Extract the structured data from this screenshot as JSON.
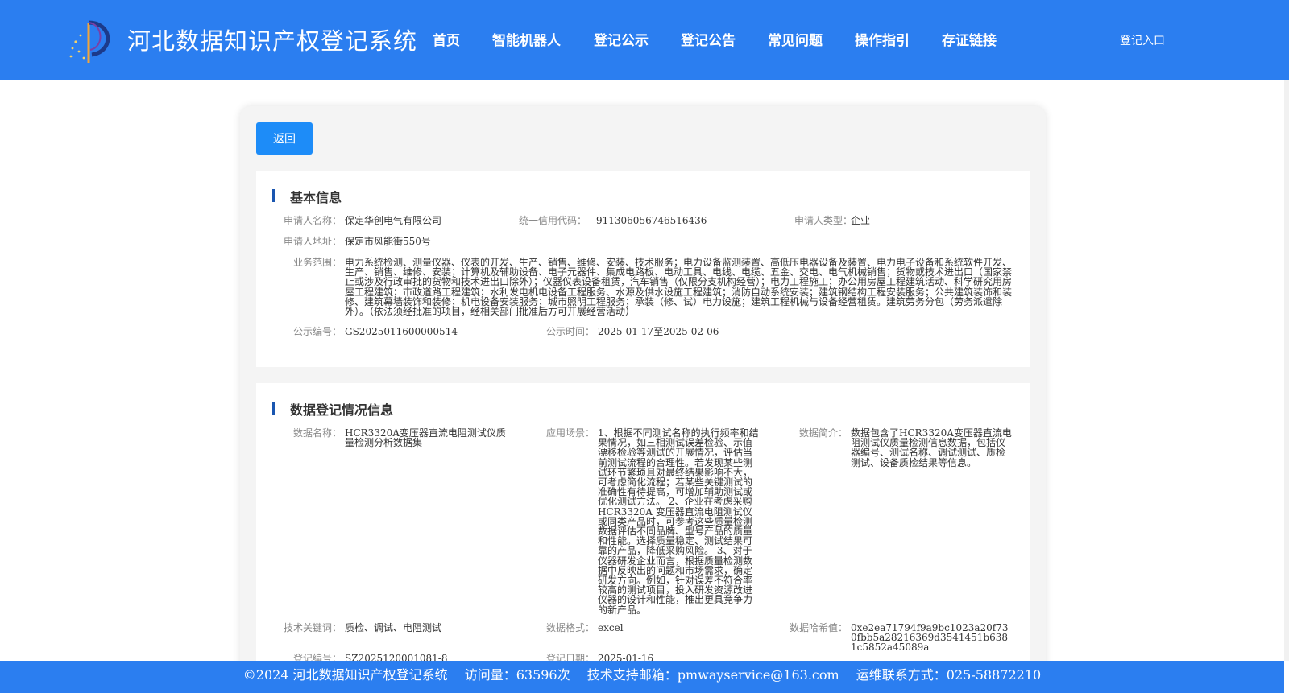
{
  "header": {
    "title": "河北数据知识产权登记系统",
    "nav": [
      "首页",
      "智能机器人",
      "登记公示",
      "登记公告",
      "常见问题",
      "操作指引",
      "存证链接"
    ],
    "login": "登记入口"
  },
  "back_label": "返回",
  "basic": {
    "title": "基本信息",
    "applicant_name_label": "申请人名称：",
    "applicant_name": "保定华创电气有限公司",
    "credit_code_label": "统一信用代码：",
    "credit_code": "911306056746516436",
    "applicant_type_label": "申请人类型：",
    "applicant_type": "企业",
    "address_label": "申请人地址：",
    "address": "保定市风能街550号",
    "scope_label": "业务范围：",
    "scope": "电力系统检测、测量仪器、仪表的开发、生产、销售、维修、安装、技术服务；电力设备监测装置、高低压电器设备及装置、电力电子设备和系统软件开发、生产、销售、维修、安装；计算机及辅助设备、电子元器件、集成电路板、电动工具、电线、电缆、五金、交电、电气机械销售；货物或技术进出口（国家禁止或涉及行政审批的货物和技术进出口除外）；仪器仪表设备租赁，汽车销售（仅限分支机构经营）；电力工程施工；办公用房屋工程建筑活动、科学研究用房屋工程建筑；市政道路工程建筑；水利发电机电设备工程服务、水源及供水设施工程建筑；消防自动系统安装；建筑钢结构工程安装服务；公共建筑装饰和装修、建筑幕墙装饰和装修；机电设备安装服务；城市照明工程服务；承装（修、试）电力设施；建筑工程机械与设备经营租赁。建筑劳务分包（劳务派遣除外）。（依法须经批准的项目，经相关部门批准后方可开展经营活动）",
    "notice_no_label": "公示编号：",
    "notice_no": "GS2025011600000514",
    "notice_time_label": "公示时间：",
    "notice_time": "2025-01-17至2025-02-06"
  },
  "registration": {
    "title": "数据登记情况信息",
    "data_name_label": "数据名称：",
    "data_name": "HCR3320A变压器直流电阻测试仪质量检测分析数据集",
    "scenario_label": "应用场景：",
    "scenario": "1、根据不同测试名称的执行频率和结果情况，如三相测试误差检验、示值漂移检验等测试的开展情况，评估当前测试流程的合理性。若发现某些测试环节繁琐且对最终结果影响不大，可考虑简化流程；若某些关键测试的准确性有待提高，可增加辅助测试或优化测试方法。 2、企业在考虑采购HCR3320A 变压器直流电阻测试仪或同类产品时，可参考这些质量检测数据评估不同品牌、型号产品的质量和性能。选择质量稳定、测试结果可靠的产品，降低采购风险。 3、对于仪器研发企业而言，根据质量检测数据中反映出的问题和市场需求，确定研发方向。例如，针对误差不符合率较高的测试项目，投入研发资源改进仪器的设计和性能，推出更具竞争力的新产品。",
    "intro_label": "数据简介：",
    "intro": "数据包含了HCR3320A变压器直流电阻测试仪质量检测信息数据，包括仪器编号、测试名称、调试测试、质检测试、设备质检结果等信息。",
    "keywords_label": "技术关键词：",
    "keywords": "质检、调试、电阻测试",
    "format_label": "数据格式：",
    "format": "excel",
    "hash_label": "数据哈希值：",
    "hash": "0xe2ea71794f9a9bc1023a20f730fbb5a28216369d3541451b6381c5852a45089a",
    "reg_no_label": "登记编号：",
    "reg_no": "SZ2025120001081-8",
    "reg_date_label": "登记日期：",
    "reg_date": "2025-01-16"
  },
  "footer": {
    "copyright": "©2024 河北数据知识产权登记系统",
    "visits": "访问量：63596次",
    "support": "技术支持邮箱：pmwayservice@163.com",
    "phone": "运维联系方式：025-58872210"
  },
  "colors": {
    "header_bg": "#2b7ef0",
    "button_bg": "#1d8cf8",
    "section_bar": "#1a56b0"
  }
}
